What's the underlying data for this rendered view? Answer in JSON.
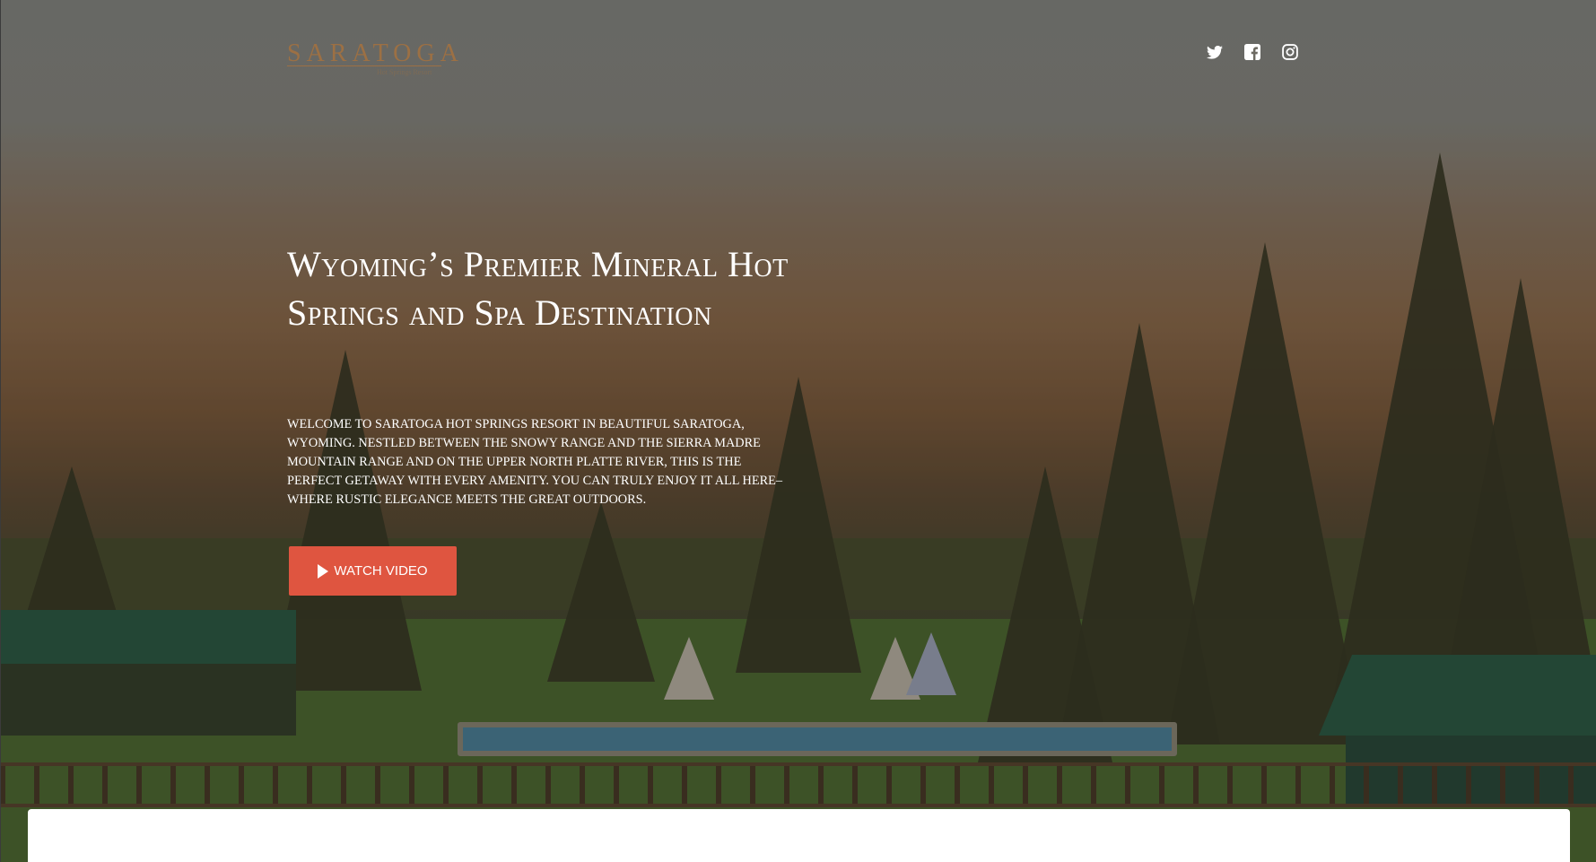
{
  "header": {
    "logo": {
      "wordmark": "SARATOGA",
      "tagline": "Hot Springs Resort"
    },
    "social": [
      {
        "name": "twitter-icon"
      },
      {
        "name": "facebook-icon"
      },
      {
        "name": "instagram-icon"
      }
    ]
  },
  "hero": {
    "headline": "Wyoming’s Premier Mineral Hot Springs and Spa Destination",
    "intro": "Welcome to Saratoga Hot Springs Resort in beautiful Saratoga, Wyoming. Nestled between the Snowy Range and the Sierra Madre Mountain Range and on the upper North Platte River, this is the perfect getaway with every amenity. You can truly enjoy it all here–where rustic elegance meets the great outdoors.",
    "cta_label": "WATCH VIDEO"
  },
  "colors": {
    "accent": "#df5540",
    "logo": "#9c7044"
  }
}
